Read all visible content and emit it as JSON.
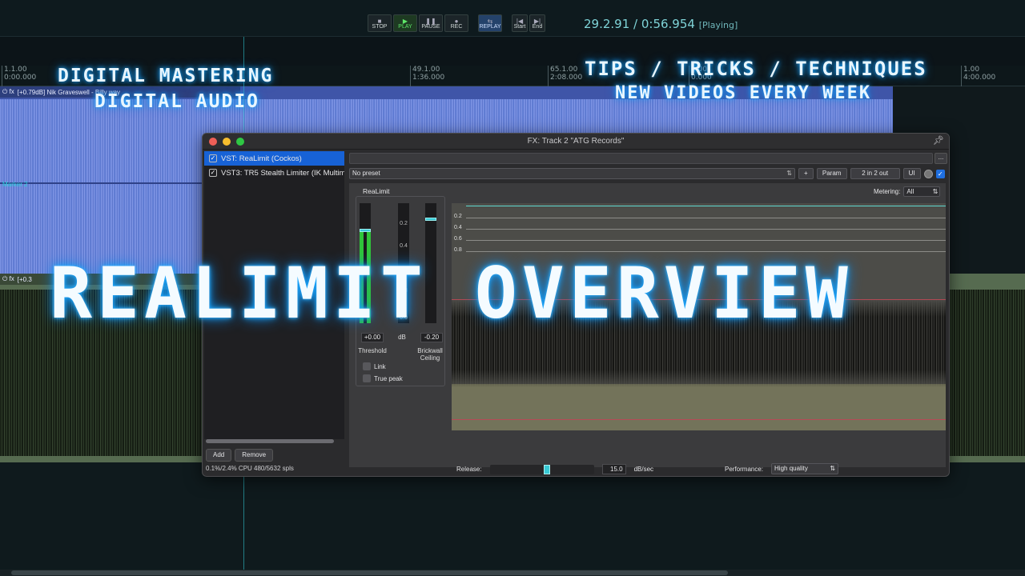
{
  "transport": {
    "buttons": [
      {
        "label": "STOP",
        "glyph": "■"
      },
      {
        "label": "PLAY",
        "glyph": "▶"
      },
      {
        "label": "PAUSE",
        "glyph": "❚❚"
      },
      {
        "label": "REC",
        "glyph": "●"
      },
      {
        "label": "REPLAY",
        "glyph": "⇆"
      },
      {
        "label": "Start",
        "glyph": "|◀"
      },
      {
        "label": "End",
        "glyph": "▶|"
      }
    ],
    "position": "29.2.91 / 0:56.954",
    "state": "[Playing]"
  },
  "ruler": [
    {
      "bar": "1.1.00",
      "time": "0:00.000"
    },
    {
      "bar": "49.1.00",
      "time": "1:36.000"
    },
    {
      "bar": "65.1.00",
      "time": "2:08.000"
    },
    {
      "bar": "1.00",
      "time": "0.000"
    },
    {
      "bar": "1.00",
      "time": "4:00.000"
    }
  ],
  "overlay": {
    "line1": "DIGITAL MASTERING",
    "line2": "DIGITAL AUDIO",
    "line3": "TIPS / TRICKS / TECHNIQUES",
    "line4": "NEW VIDEOS EVERY WEEK",
    "headline": "REALIMIT OVERVIEW"
  },
  "tracks": {
    "track1_label": "[+0.79dB] Nik Graveswell - Billy way",
    "track1_marker": "Marker 2",
    "track2_label": "[+0.3"
  },
  "fx_window": {
    "title": "FX: Track 2 \"ATG Records\"",
    "chain": [
      {
        "name": "VST: ReaLimit (Cockos)",
        "selected": true
      },
      {
        "name": "VST3: TR5 Stealth Limiter (IK Multimedia)",
        "selected": false
      }
    ],
    "add_label": "Add",
    "remove_label": "Remove",
    "cpu": "0.1%/2.4% CPU 480/5632 spls",
    "dots_label": "...",
    "preset": "No preset",
    "plus_label": "+",
    "param_label": "Param",
    "io_label": "2 in 2 out",
    "ui_label": "UI"
  },
  "realimit": {
    "name": "ReaLimit",
    "scale": [
      "0.2",
      "0.4",
      "0.8",
      "0.0"
    ],
    "threshold_value": "+0.00",
    "unit": "dB",
    "ceiling_value": "-0.20",
    "threshold_label": "Threshold",
    "ceiling_label": "Brickwall Ceiling",
    "link_label": "Link",
    "truepeak_label": "True peak",
    "metering_label": "Metering:",
    "metering_value": "All",
    "graph_ticks": [
      "0.2",
      "0.4",
      "0.6",
      "0.8"
    ],
    "release_label": "Release:",
    "release_value": "15.0",
    "release_unit": "dB/sec",
    "release_level": 0.55,
    "threshold_level": 0.78,
    "ceiling_level": 0.88,
    "performance_label": "Performance:",
    "performance_value": "High quality"
  },
  "colors": {
    "accent": "#1762d6",
    "meter": "#2fc43a",
    "handle": "#38c9d5",
    "glow": "#1aa8ff"
  }
}
